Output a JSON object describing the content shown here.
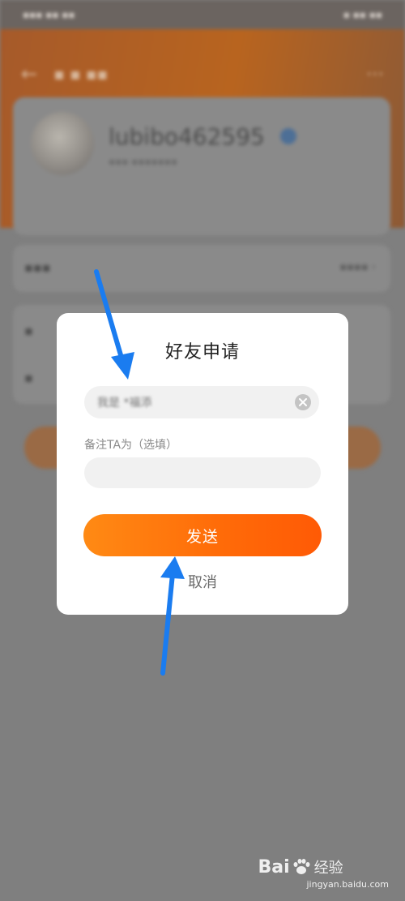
{
  "background_app": {
    "username": "lubibo462595"
  },
  "dialog": {
    "title": "好友申请",
    "message_value": "我是 *福添",
    "remark_label": "备注TA为（选填）",
    "remark_value": "",
    "send_label": "发送",
    "cancel_label": "取消"
  },
  "colors": {
    "send_button_start": "#ff8a14",
    "send_button_end": "#ff5a05",
    "annotation_arrow": "#1a7cf0",
    "overlay": "#7f7f7f"
  },
  "watermark": {
    "brand_left": "Bai",
    "brand_right": "经验",
    "url": "jingyan.baidu.com"
  }
}
